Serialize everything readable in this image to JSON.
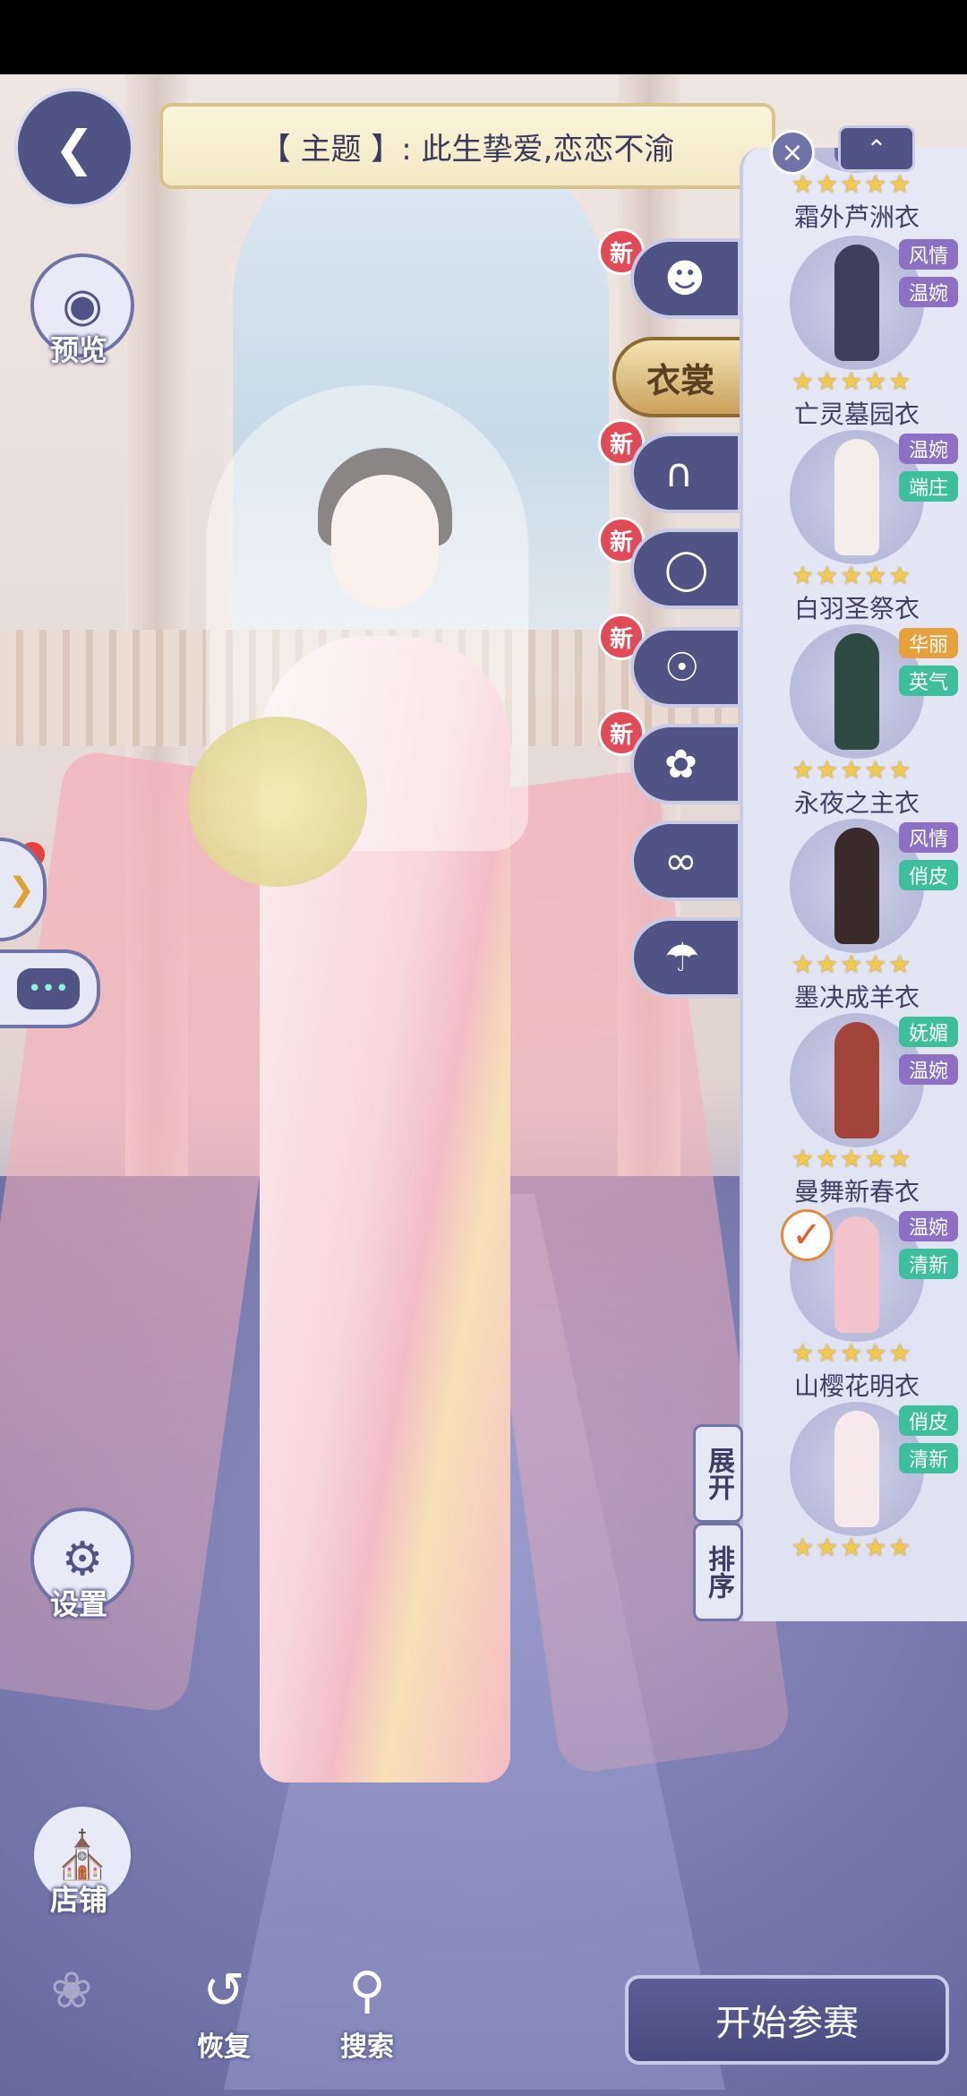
{
  "theme": {
    "text": "【 主题 】:  此生挚爱,恋恋不渝"
  },
  "left_menu": {
    "preview": "预览",
    "settings": "设置",
    "shop": "店铺"
  },
  "categories": [
    {
      "id": "hair",
      "icon": "hair-icon",
      "new": "新",
      "label": ""
    },
    {
      "id": "clothes",
      "icon": "clothes-icon",
      "new": "",
      "label": "衣裳",
      "active": true
    },
    {
      "id": "socks",
      "icon": "socks-icon",
      "new": "新",
      "label": ""
    },
    {
      "id": "shoes",
      "icon": "shoes-icon",
      "new": "新",
      "label": ""
    },
    {
      "id": "earrings",
      "icon": "earrings-icon",
      "new": "新",
      "label": ""
    },
    {
      "id": "hairpin",
      "icon": "hairpin-icon",
      "new": "新",
      "label": ""
    },
    {
      "id": "veil",
      "icon": "veil-icon",
      "new": "",
      "label": ""
    },
    {
      "id": "cloak",
      "icon": "cloak-icon",
      "new": "",
      "label": ""
    }
  ],
  "items": [
    {
      "name": "霜外芦洲衣",
      "tags": [],
      "stars": "★★★★★"
    },
    {
      "name": "亡灵墓园衣",
      "tags": [
        "风情",
        "温婉"
      ],
      "stars": "★★★★★"
    },
    {
      "name": "白羽圣祭衣",
      "tags": [
        "温婉",
        "端庄"
      ],
      "stars": "★★★★★"
    },
    {
      "name": "永夜之主衣",
      "tags": [
        "华丽",
        "英气"
      ],
      "stars": "★★★★★"
    },
    {
      "name": "墨决成羊衣",
      "tags": [
        "风情",
        "俏皮"
      ],
      "stars": "★★★★★"
    },
    {
      "name": "曼舞新春衣",
      "tags": [
        "妩媚",
        "温婉"
      ],
      "stars": "★★★★★"
    },
    {
      "name": "山樱花明衣",
      "tags": [
        "温婉",
        "清新"
      ],
      "stars": "★★★★★",
      "selected": true
    },
    {
      "name": "",
      "tags": [
        "俏皮",
        "清新"
      ],
      "stars": "★★★★★"
    }
  ],
  "panel_buttons": {
    "expand": "展开",
    "sort": "排序"
  },
  "bottom_bar": {
    "restore": "恢复",
    "search": "搜索",
    "start": "开始参赛"
  },
  "colors": {
    "primary": "#4f5485",
    "panel": "#e6e8f6",
    "tag_purple": "#8d6fc4",
    "tag_teal": "#3dbf9d",
    "tag_orange": "#e6a13c"
  }
}
